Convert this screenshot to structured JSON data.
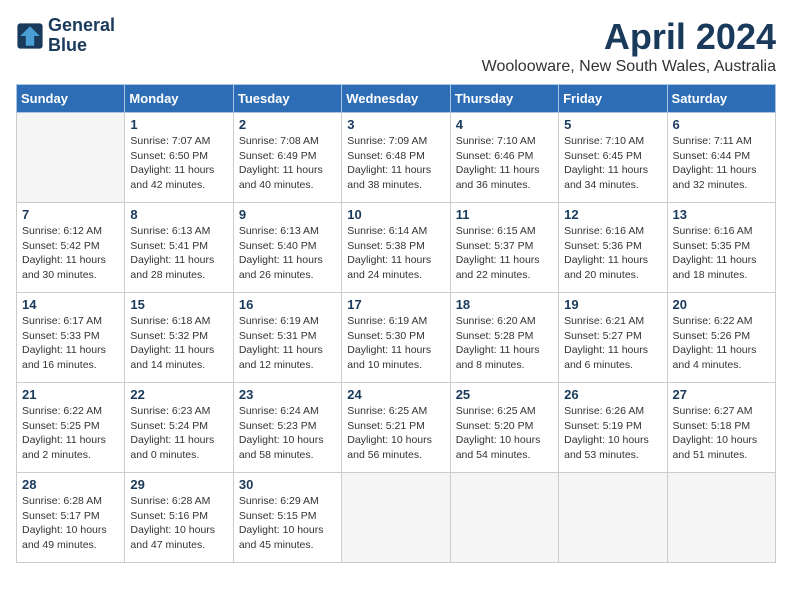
{
  "header": {
    "logo_line1": "General",
    "logo_line2": "Blue",
    "month_title": "April 2024",
    "subtitle": "Woolooware, New South Wales, Australia"
  },
  "calendar": {
    "day_headers": [
      "Sunday",
      "Monday",
      "Tuesday",
      "Wednesday",
      "Thursday",
      "Friday",
      "Saturday"
    ],
    "weeks": [
      [
        {
          "day": "",
          "info": ""
        },
        {
          "day": "1",
          "info": "Sunrise: 7:07 AM\nSunset: 6:50 PM\nDaylight: 11 hours\nand 42 minutes."
        },
        {
          "day": "2",
          "info": "Sunrise: 7:08 AM\nSunset: 6:49 PM\nDaylight: 11 hours\nand 40 minutes."
        },
        {
          "day": "3",
          "info": "Sunrise: 7:09 AM\nSunset: 6:48 PM\nDaylight: 11 hours\nand 38 minutes."
        },
        {
          "day": "4",
          "info": "Sunrise: 7:10 AM\nSunset: 6:46 PM\nDaylight: 11 hours\nand 36 minutes."
        },
        {
          "day": "5",
          "info": "Sunrise: 7:10 AM\nSunset: 6:45 PM\nDaylight: 11 hours\nand 34 minutes."
        },
        {
          "day": "6",
          "info": "Sunrise: 7:11 AM\nSunset: 6:44 PM\nDaylight: 11 hours\nand 32 minutes."
        }
      ],
      [
        {
          "day": "7",
          "info": "Sunrise: 6:12 AM\nSunset: 5:42 PM\nDaylight: 11 hours\nand 30 minutes."
        },
        {
          "day": "8",
          "info": "Sunrise: 6:13 AM\nSunset: 5:41 PM\nDaylight: 11 hours\nand 28 minutes."
        },
        {
          "day": "9",
          "info": "Sunrise: 6:13 AM\nSunset: 5:40 PM\nDaylight: 11 hours\nand 26 minutes."
        },
        {
          "day": "10",
          "info": "Sunrise: 6:14 AM\nSunset: 5:38 PM\nDaylight: 11 hours\nand 24 minutes."
        },
        {
          "day": "11",
          "info": "Sunrise: 6:15 AM\nSunset: 5:37 PM\nDaylight: 11 hours\nand 22 minutes."
        },
        {
          "day": "12",
          "info": "Sunrise: 6:16 AM\nSunset: 5:36 PM\nDaylight: 11 hours\nand 20 minutes."
        },
        {
          "day": "13",
          "info": "Sunrise: 6:16 AM\nSunset: 5:35 PM\nDaylight: 11 hours\nand 18 minutes."
        }
      ],
      [
        {
          "day": "14",
          "info": "Sunrise: 6:17 AM\nSunset: 5:33 PM\nDaylight: 11 hours\nand 16 minutes."
        },
        {
          "day": "15",
          "info": "Sunrise: 6:18 AM\nSunset: 5:32 PM\nDaylight: 11 hours\nand 14 minutes."
        },
        {
          "day": "16",
          "info": "Sunrise: 6:19 AM\nSunset: 5:31 PM\nDaylight: 11 hours\nand 12 minutes."
        },
        {
          "day": "17",
          "info": "Sunrise: 6:19 AM\nSunset: 5:30 PM\nDaylight: 11 hours\nand 10 minutes."
        },
        {
          "day": "18",
          "info": "Sunrise: 6:20 AM\nSunset: 5:28 PM\nDaylight: 11 hours\nand 8 minutes."
        },
        {
          "day": "19",
          "info": "Sunrise: 6:21 AM\nSunset: 5:27 PM\nDaylight: 11 hours\nand 6 minutes."
        },
        {
          "day": "20",
          "info": "Sunrise: 6:22 AM\nSunset: 5:26 PM\nDaylight: 11 hours\nand 4 minutes."
        }
      ],
      [
        {
          "day": "21",
          "info": "Sunrise: 6:22 AM\nSunset: 5:25 PM\nDaylight: 11 hours\nand 2 minutes."
        },
        {
          "day": "22",
          "info": "Sunrise: 6:23 AM\nSunset: 5:24 PM\nDaylight: 11 hours\nand 0 minutes."
        },
        {
          "day": "23",
          "info": "Sunrise: 6:24 AM\nSunset: 5:23 PM\nDaylight: 10 hours\nand 58 minutes."
        },
        {
          "day": "24",
          "info": "Sunrise: 6:25 AM\nSunset: 5:21 PM\nDaylight: 10 hours\nand 56 minutes."
        },
        {
          "day": "25",
          "info": "Sunrise: 6:25 AM\nSunset: 5:20 PM\nDaylight: 10 hours\nand 54 minutes."
        },
        {
          "day": "26",
          "info": "Sunrise: 6:26 AM\nSunset: 5:19 PM\nDaylight: 10 hours\nand 53 minutes."
        },
        {
          "day": "27",
          "info": "Sunrise: 6:27 AM\nSunset: 5:18 PM\nDaylight: 10 hours\nand 51 minutes."
        }
      ],
      [
        {
          "day": "28",
          "info": "Sunrise: 6:28 AM\nSunset: 5:17 PM\nDaylight: 10 hours\nand 49 minutes."
        },
        {
          "day": "29",
          "info": "Sunrise: 6:28 AM\nSunset: 5:16 PM\nDaylight: 10 hours\nand 47 minutes."
        },
        {
          "day": "30",
          "info": "Sunrise: 6:29 AM\nSunset: 5:15 PM\nDaylight: 10 hours\nand 45 minutes."
        },
        {
          "day": "",
          "info": ""
        },
        {
          "day": "",
          "info": ""
        },
        {
          "day": "",
          "info": ""
        },
        {
          "day": "",
          "info": ""
        }
      ]
    ]
  }
}
